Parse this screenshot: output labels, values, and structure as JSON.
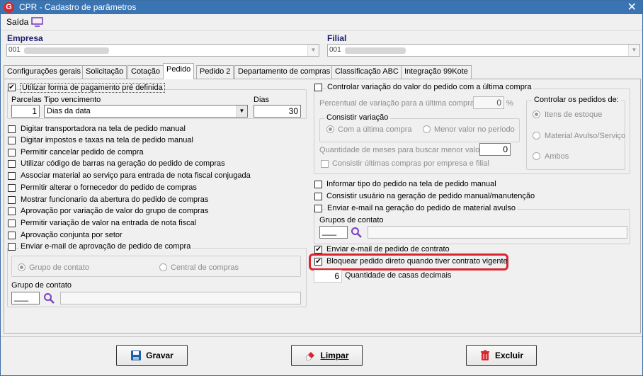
{
  "window": {
    "title": "CPR - Cadastro de parâmetros",
    "icon": "app-logo-icon",
    "close": "✕"
  },
  "menu": {
    "saida": "Saída"
  },
  "empresa": {
    "label": "Empresa",
    "code": "001"
  },
  "filial": {
    "label": "Filial",
    "code": "001"
  },
  "tabs": [
    "Configurações gerais",
    "Solicitação",
    "Cotação",
    "Pedido",
    "Pedido 2",
    "Departamento de compras",
    "Classificação ABC",
    "Integração 99Kote"
  ],
  "active_tab": "Pedido",
  "left": {
    "pagamento": {
      "label": "Utilizar forma de pagamento pré definida",
      "checked": true,
      "parcelas_label": "Parcelas",
      "parcelas_value": "1",
      "tipo_label": "Tipo vencimento",
      "tipo_value": "Dias da data",
      "dias_label": "Dias",
      "dias_value": "30"
    },
    "options": [
      "Digitar transportadora na tela de pedido manual",
      "Digitar impostos e taxas na tela de pedido manual",
      "Permitir cancelar pedido de compra",
      "Utilizar código de barras na geração do pedido de compras",
      "Associar material ao serviço para entrada de nota fiscal conjugada",
      "Permitir alterar o fornecedor do pedido de compras",
      "Mostrar funcionario da abertura do pedido de compras",
      "Aprovação por variação de valor do grupo de compras",
      "Permitir variação de valor na entrada de nota fiscal",
      "Aprovação conjunta por setor"
    ],
    "email_aprov": {
      "label": "Enviar e-mail de aprovação de pedido de compra",
      "radio1": "Grupo de contato",
      "radio2": "Central de compras",
      "grupo_label": "Grupo de contato",
      "grupo_value": "___"
    }
  },
  "right": {
    "variacao": {
      "label": "Controlar variação do valor do pedido com a última compra",
      "percentual_label": "Percentual de variação para a última compra",
      "percentual_value": "0",
      "percent_sign": "%",
      "consistir_label": "Consistir variação",
      "consistir_r1": "Com a última compra",
      "consistir_r2": "Menor valor no período",
      "meses_label": "Quantidade de meses para buscar menor valor",
      "meses_value": "0",
      "consistir_empresa": "Consistir últimas compras por empresa e filial",
      "controlar_label": "Controlar os pedidos de:",
      "ctrl_r1": "Itens de estoque",
      "ctrl_r2": "Material Avulso/Serviço",
      "ctrl_r3": "Ambos"
    },
    "informar_tipo": "Informar tipo do pedido na tela de pedido manual",
    "consistir_usuario": "Consistir usuário na geração de pedido manual/manutenção",
    "email_avulso": {
      "label": "Enviar e-mail na geração do pedido de material avulso",
      "grupos_label": "Grupos de contato",
      "grupos_value": "___"
    },
    "email_contrato": {
      "label": "Enviar e-mail de pedido de contrato",
      "checked": true
    },
    "bloquear": {
      "label": "Bloquear pedido direto quando tiver contrato vigente",
      "checked": true
    },
    "casas": {
      "value": "6",
      "label": "Quantidade de casas decimais"
    }
  },
  "buttons": {
    "gravar": "Gravar",
    "limpar": "Limpar",
    "excluir": "Excluir"
  },
  "colors": {
    "titlebar": "#3b74b2",
    "highlight": "#d9262e",
    "accent": "#7b3fc4"
  }
}
